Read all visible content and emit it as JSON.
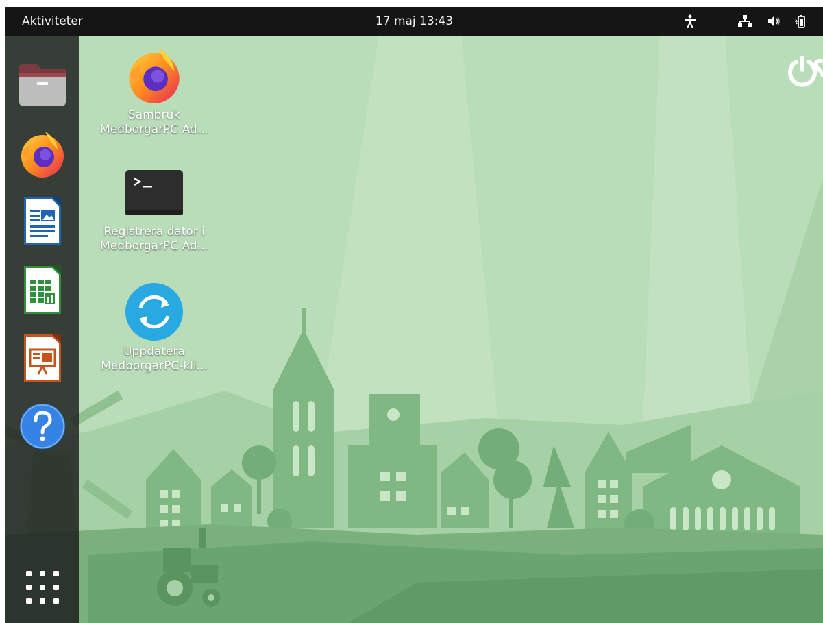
{
  "topbar": {
    "activities_label": "Aktiviteter",
    "clock": "17 maj  13:43",
    "tray_icons": [
      "accessibility-icon",
      "network-icon",
      "volume-icon",
      "battery-icon"
    ]
  },
  "dock": {
    "items": [
      {
        "name": "Files",
        "icon": "folder-icon"
      },
      {
        "name": "Firefox",
        "icon": "firefox-icon"
      },
      {
        "name": "LibreOffice Writer",
        "icon": "writer-icon"
      },
      {
        "name": "LibreOffice Calc",
        "icon": "calc-icon"
      },
      {
        "name": "LibreOffice Impress",
        "icon": "impress-icon"
      },
      {
        "name": "Help",
        "icon": "help-icon"
      }
    ],
    "show_apps_icon": "app-grid-icon"
  },
  "desktop": {
    "icons": [
      {
        "label_line1": "Sambruk",
        "label_line2": "MedborgarPC Ad...",
        "icon": "firefox-icon"
      },
      {
        "label_line1": "Registrera dator i",
        "label_line2": "MedborgarPC Ad...",
        "icon": "terminal-icon"
      },
      {
        "label_line1": "Uppdatera",
        "label_line2": "MedborgarPC-kli...",
        "icon": "sync-icon"
      }
    ]
  },
  "colors": {
    "wallpaper_light": "#b9dcb9",
    "wallpaper_dark": "#6aa570",
    "topbar": "#151515",
    "help_blue": "#3584e4",
    "sync_blue": "#29a9e1"
  }
}
